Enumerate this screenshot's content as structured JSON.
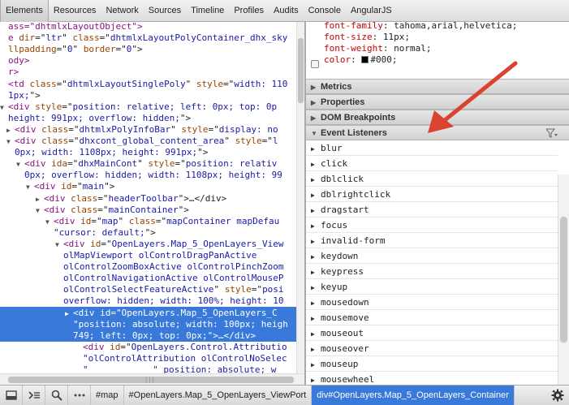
{
  "tabs": [
    "Elements",
    "Resources",
    "Network",
    "Sources",
    "Timeline",
    "Profiles",
    "Audits",
    "Console",
    "AngularJS"
  ],
  "dom_lines": [
    {
      "indent": 0,
      "tri": "",
      "sel": false,
      "parts": [
        [
          "t",
          "ass=\"dhtmlxLayoutObject\">"
        ]
      ]
    },
    {
      "indent": 0,
      "tri": "",
      "sel": false,
      "parts": [
        [
          "t",
          "e "
        ],
        [
          "a",
          "dir"
        ],
        [
          "p",
          "=\""
        ],
        [
          "v",
          "ltr"
        ],
        [
          "p",
          "\" "
        ],
        [
          "a",
          "class"
        ],
        [
          "p",
          "=\""
        ],
        [
          "v",
          "dhtmlxLayoutPolyContainer_dhx_sky"
        ]
      ]
    },
    {
      "indent": 0,
      "tri": "",
      "sel": false,
      "parts": [
        [
          "a",
          "llpadding"
        ],
        [
          "p",
          "=\""
        ],
        [
          "v",
          "0"
        ],
        [
          "p",
          "\" "
        ],
        [
          "a",
          "border"
        ],
        [
          "p",
          "=\""
        ],
        [
          "v",
          "0"
        ],
        [
          "p",
          "\">"
        ]
      ]
    },
    {
      "indent": 0,
      "tri": "",
      "sel": false,
      "parts": [
        [
          "t",
          "ody>"
        ]
      ]
    },
    {
      "indent": 0,
      "tri": "",
      "sel": false,
      "parts": [
        [
          "t",
          "r>"
        ]
      ]
    },
    {
      "indent": 0,
      "tri": "",
      "sel": false,
      "parts": [
        [
          "t",
          "<td "
        ],
        [
          "a",
          "class"
        ],
        [
          "p",
          "=\""
        ],
        [
          "v",
          "dhtmlxLayoutSinglePoly"
        ],
        [
          "p",
          "\" "
        ],
        [
          "a",
          "style"
        ],
        [
          "p",
          "=\""
        ],
        [
          "v",
          "width: 110"
        ]
      ]
    },
    {
      "indent": 0,
      "tri": "",
      "sel": false,
      "parts": [
        [
          "v",
          "1px;"
        ],
        [
          "p",
          "\">"
        ]
      ]
    },
    {
      "indent": 0,
      "tri": "▼",
      "sel": false,
      "parts": [
        [
          "t",
          "<div "
        ],
        [
          "a",
          "style"
        ],
        [
          "p",
          "=\""
        ],
        [
          "v",
          "position: relative; left: 0px; top: 0p"
        ]
      ]
    },
    {
      "indent": 0,
      "tri": "",
      "sel": false,
      "parts": [
        [
          "v",
          "height: 991px; overflow: hidden;"
        ],
        [
          "p",
          "\">"
        ]
      ]
    },
    {
      "indent": 8,
      "tri": "▶",
      "sel": false,
      "parts": [
        [
          "t",
          "<div "
        ],
        [
          "a",
          "class"
        ],
        [
          "p",
          "=\""
        ],
        [
          "v",
          "dhtmlxPolyInfoBar"
        ],
        [
          "p",
          "\" "
        ],
        [
          "a",
          "style"
        ],
        [
          "p",
          "=\""
        ],
        [
          "v",
          "display: no"
        ]
      ]
    },
    {
      "indent": 8,
      "tri": "▼",
      "sel": false,
      "parts": [
        [
          "t",
          "<div "
        ],
        [
          "a",
          "class"
        ],
        [
          "p",
          "=\""
        ],
        [
          "v",
          "dhxcont_global_content_area"
        ],
        [
          "p",
          "\" "
        ],
        [
          "a",
          "style"
        ],
        [
          "p",
          "=\""
        ],
        [
          "v",
          "l"
        ]
      ]
    },
    {
      "indent": 8,
      "tri": "",
      "sel": false,
      "parts": [
        [
          "v",
          "0px; width: 1108px; height: 991px;"
        ],
        [
          "p",
          "\">"
        ]
      ]
    },
    {
      "indent": 20,
      "tri": "▼",
      "sel": false,
      "parts": [
        [
          "t",
          "<div "
        ],
        [
          "a",
          "ida"
        ],
        [
          "p",
          "=\""
        ],
        [
          "v",
          "dhxMainCont"
        ],
        [
          "p",
          "\" "
        ],
        [
          "a",
          "style"
        ],
        [
          "p",
          "=\""
        ],
        [
          "v",
          "position: relativ"
        ]
      ]
    },
    {
      "indent": 20,
      "tri": "",
      "sel": false,
      "parts": [
        [
          "v",
          "0px; overflow: hidden; width: 1108px; height: 99"
        ]
      ]
    },
    {
      "indent": 32,
      "tri": "▼",
      "sel": false,
      "parts": [
        [
          "t",
          "<div "
        ],
        [
          "a",
          "id"
        ],
        [
          "p",
          "=\""
        ],
        [
          "v",
          "main"
        ],
        [
          "p",
          "\">"
        ]
      ]
    },
    {
      "indent": 44,
      "tri": "▶",
      "sel": false,
      "parts": [
        [
          "t",
          "<div "
        ],
        [
          "a",
          "class"
        ],
        [
          "p",
          "=\""
        ],
        [
          "v",
          "headerToolbar"
        ],
        [
          "p",
          "\">…</div>"
        ]
      ]
    },
    {
      "indent": 44,
      "tri": "▼",
      "sel": false,
      "parts": [
        [
          "t",
          "<div "
        ],
        [
          "a",
          "class"
        ],
        [
          "p",
          "=\""
        ],
        [
          "v",
          "mainContainer"
        ],
        [
          "p",
          "\">"
        ]
      ]
    },
    {
      "indent": 56,
      "tri": "▼",
      "sel": false,
      "parts": [
        [
          "t",
          "<div "
        ],
        [
          "a",
          "id"
        ],
        [
          "p",
          "=\""
        ],
        [
          "v",
          "map"
        ],
        [
          "p",
          "\" "
        ],
        [
          "a",
          "class"
        ],
        [
          "p",
          "=\""
        ],
        [
          "v",
          "mapContainer mapDefau"
        ]
      ]
    },
    {
      "indent": 56,
      "tri": "",
      "sel": false,
      "parts": [
        [
          "v",
          "\"cursor: default;"
        ],
        [
          "p",
          "\">"
        ]
      ]
    },
    {
      "indent": 68,
      "tri": "▼",
      "sel": false,
      "parts": [
        [
          "t",
          "<div "
        ],
        [
          "a",
          "id"
        ],
        [
          "p",
          "=\""
        ],
        [
          "v",
          "OpenLayers.Map_5_OpenLayers_View"
        ]
      ]
    },
    {
      "indent": 68,
      "tri": "",
      "sel": false,
      "parts": [
        [
          "v",
          "olMapViewport olControlDragPanActive"
        ]
      ]
    },
    {
      "indent": 68,
      "tri": "",
      "sel": false,
      "parts": [
        [
          "v",
          "olControlZoomBoxActive olControlPinchZoom"
        ]
      ]
    },
    {
      "indent": 68,
      "tri": "",
      "sel": false,
      "parts": [
        [
          "v",
          "olControlNavigationActive olControlMouseP"
        ]
      ]
    },
    {
      "indent": 68,
      "tri": "",
      "sel": false,
      "parts": [
        [
          "v",
          "olControlSelectFeatureActive"
        ],
        [
          "p",
          "\" "
        ],
        [
          "a",
          "style"
        ],
        [
          "p",
          "=\""
        ],
        [
          "v",
          "posi"
        ]
      ]
    },
    {
      "indent": 68,
      "tri": "",
      "sel": false,
      "parts": [
        [
          "v",
          "overflow: hidden; width: 100%; height: 10"
        ]
      ]
    },
    {
      "indent": 80,
      "tri": "▶",
      "sel": true,
      "parts": [
        [
          "t",
          "<div "
        ],
        [
          "a",
          "id"
        ],
        [
          "p",
          "=\""
        ],
        [
          "v",
          "OpenLayers.Map_5_OpenLayers_C"
        ]
      ]
    },
    {
      "indent": 80,
      "tri": "",
      "sel": true,
      "parts": [
        [
          "v",
          "\"position: absolute; width: 100px; heigh"
        ]
      ]
    },
    {
      "indent": 80,
      "tri": "",
      "sel": true,
      "parts": [
        [
          "v",
          "749; left: 0px; top: 0px;"
        ],
        [
          "p",
          "\">…</div>"
        ]
      ]
    },
    {
      "indent": 92,
      "tri": "",
      "sel": false,
      "parts": [
        [
          "t",
          "<div "
        ],
        [
          "a",
          "id"
        ],
        [
          "p",
          "=\""
        ],
        [
          "v",
          "OpenLayers.Control.Attributio"
        ]
      ]
    },
    {
      "indent": 92,
      "tri": "",
      "sel": false,
      "parts": [
        [
          "v",
          "\"olControlAttribution olControlNoSelec"
        ]
      ]
    },
    {
      "indent": 92,
      "tri": "",
      "sel": false,
      "parts": [
        [
          "v",
          "\"            \" position: absolute; w"
        ]
      ]
    }
  ],
  "styles": {
    "rules": [
      {
        "prop": "font-family",
        "val": "tahoma,arial,helvetica;"
      },
      {
        "prop": "font-size",
        "val": "11px;"
      },
      {
        "prop": "font-weight",
        "val": "normal;"
      },
      {
        "prop": "color",
        "val": "#000;",
        "swatch": "#000000"
      }
    ]
  },
  "panes": [
    {
      "label": "Metrics",
      "expanded": false
    },
    {
      "label": "Properties",
      "expanded": false
    },
    {
      "label": "DOM Breakpoints",
      "expanded": false
    },
    {
      "label": "Event Listeners",
      "expanded": true
    }
  ],
  "event_listeners": [
    "blur",
    "click",
    "dblclick",
    "dblrightclick",
    "dragstart",
    "focus",
    "invalid-form",
    "keydown",
    "keypress",
    "keyup",
    "mousedown",
    "mousemove",
    "mouseout",
    "mouseover",
    "mouseup",
    "mousewheel"
  ],
  "breadcrumbs": [
    "#map",
    "#OpenLayers.Map_5_OpenLayers_ViewPort",
    "div#OpenLayers.Map_5_OpenLayers_Container"
  ],
  "colors": {
    "selection": "#3879d9",
    "annotation_arrow": "#d9432f"
  }
}
